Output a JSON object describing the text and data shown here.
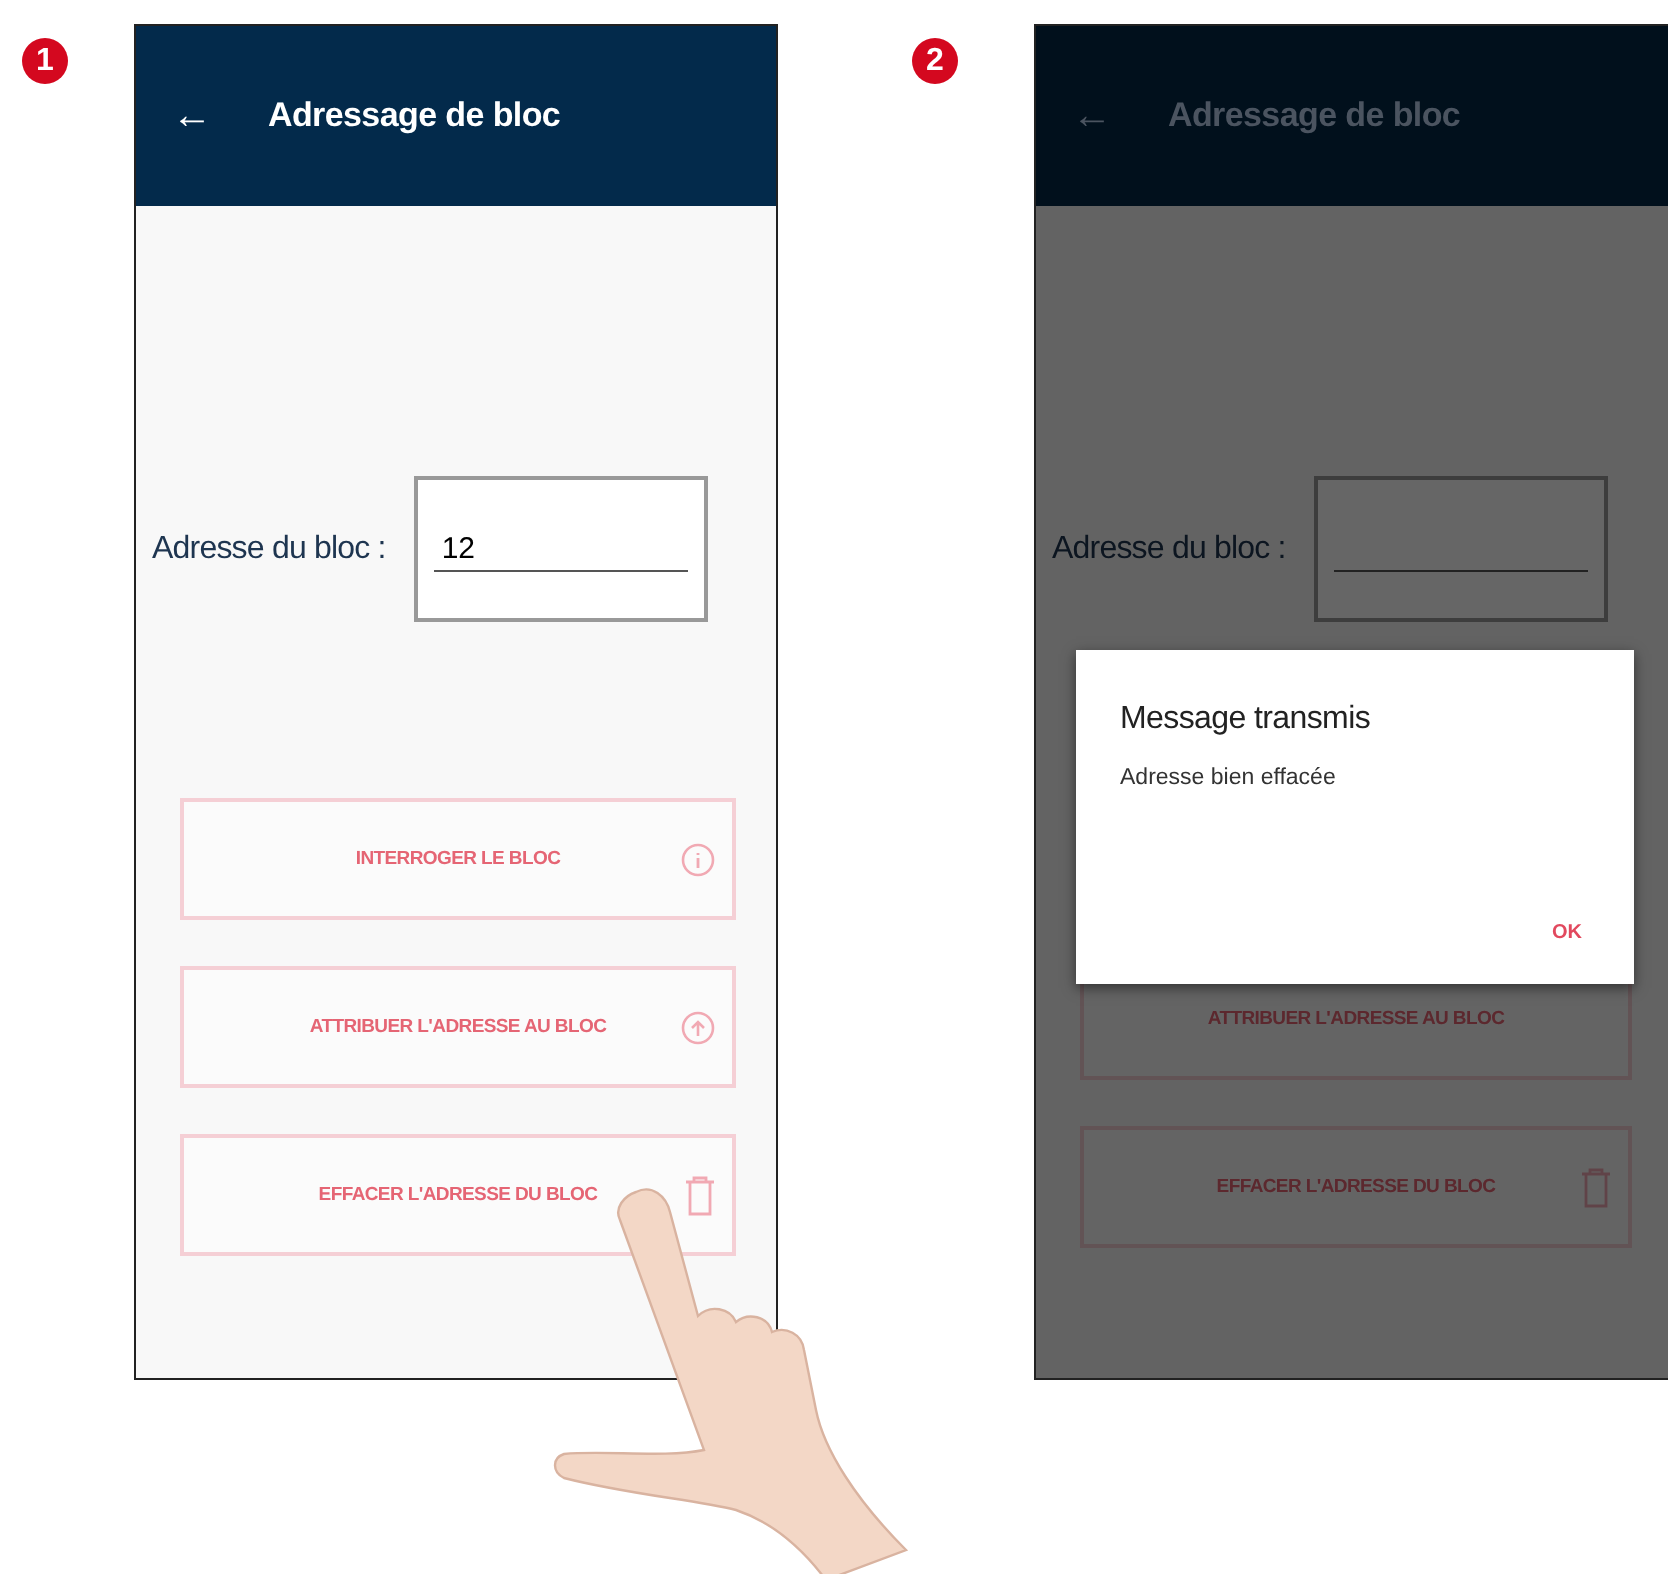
{
  "steps": [
    {
      "number": "1",
      "touch": true,
      "screen": {
        "back": "←",
        "title": "Adressage de bloc",
        "field_label": "Adresse du bloc :",
        "field_value": "12",
        "buttons": [
          {
            "label": "INTERROGER LE BLOC",
            "kind": "query"
          },
          {
            "label": "ATTRIBUER L'ADRESSE AU BLOC",
            "kind": "assign"
          },
          {
            "label": "EFFACER L'ADRESSE DU BLOC",
            "kind": "erase"
          }
        ]
      }
    },
    {
      "number": "2",
      "touch": false,
      "screen": {
        "back": "←",
        "title": "Adressage de bloc",
        "field_label": "Adresse du bloc :",
        "buttons": [
          {
            "label": "ATTRIBUER L'ADRESSE AU BLOC",
            "kind": "plain"
          },
          {
            "label": "EFFACER L'ADRESSE DU BLOC",
            "kind": "erase"
          }
        ],
        "dialog": {
          "title": "Message transmis",
          "message": "Adresse bien effacée",
          "action": "OK"
        }
      }
    }
  ]
}
